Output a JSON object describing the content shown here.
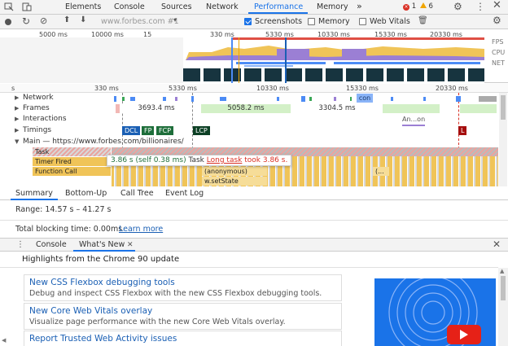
{
  "tabs": {
    "items": [
      "Elements",
      "Console",
      "Sources",
      "Network",
      "Performance",
      "Memory"
    ],
    "active": "Performance",
    "more": "»",
    "errors": "1",
    "warnings": "6"
  },
  "toolbar": {
    "url_placeholder": "www.forbes.com #1",
    "screenshots_label": "Screenshots",
    "memory_label": "Memory",
    "webvitals_label": "Web Vitals"
  },
  "overview": {
    "ticks": [
      "5000 ms",
      "10000 ms",
      "15",
      "330 ms",
      "5330 ms",
      "10330 ms",
      "15330 ms",
      "20330 ms"
    ],
    "lanes": [
      "FPS",
      "CPU",
      "NET"
    ]
  },
  "timeline": {
    "ticks": [
      "330 ms",
      "5330 ms",
      "10330 ms",
      "15330 ms",
      "20330 ms"
    ],
    "tracks": {
      "network": "Network",
      "frames": "Frames",
      "interactions": "Interactions",
      "timings": "Timings",
      "main": "Main — https://www.forbes.com/billionaires/"
    },
    "network_marker": "con",
    "frames": [
      "3693.4 ms",
      "5058.2 ms",
      "3304.5 ms"
    ],
    "interaction": "An...on",
    "timing_markers": [
      "DCL",
      "FP",
      "FCP",
      "LCP",
      "L"
    ],
    "flame_labels": [
      "Task",
      "Timer Fired",
      "Function Call"
    ],
    "flame_sub": [
      "(anonymous)",
      "w.setState",
      "(..."
    ]
  },
  "tooltip": {
    "time": "3.86 s (self 0.38 ms)",
    "name": "Task",
    "link": "Long task",
    "suffix": "took 3.86 s."
  },
  "summary": {
    "tabs": [
      "Summary",
      "Bottom-Up",
      "Call Tree",
      "Event Log"
    ],
    "active": "Summary",
    "range": "Range: 14.57 s – 41.27 s",
    "blocking": "Total blocking time: 0.00ms",
    "learn_more": "Learn more"
  },
  "drawer": {
    "tabs": [
      "Console",
      "What's New"
    ],
    "active": "What's New",
    "highlights": "Highlights from the Chrome 90 update",
    "cards": [
      {
        "title": "New CSS Flexbox debugging tools",
        "desc": "Debug and inspect CSS Flexbox with the new CSS Flexbox debugging tools."
      },
      {
        "title": "New Core Web Vitals overlay",
        "desc": "Visualize page performance with the new Core Web Vitals overlay."
      },
      {
        "title": "Report Trusted Web Activity issues",
        "desc": ""
      }
    ]
  },
  "colors": {
    "accent": "#1a73e8",
    "task_red": "#d93025",
    "scripting_yellow": "#f0c458",
    "frame_green": "#d3f0c7",
    "timing_blue": "#1a5fb4",
    "timing_green": "#1e6e3a"
  }
}
